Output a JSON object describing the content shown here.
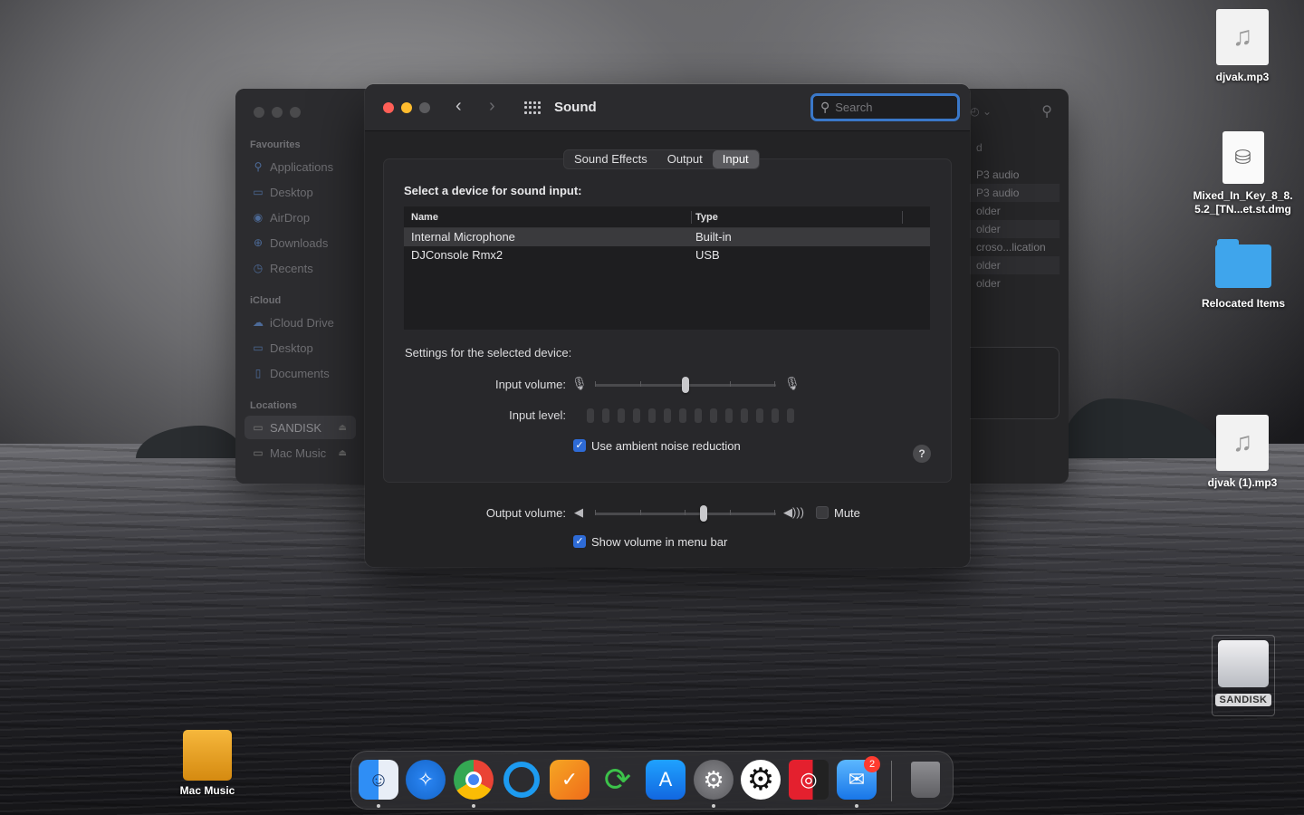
{
  "sound_window": {
    "title": "Sound",
    "search_placeholder": "Search",
    "tabs": [
      {
        "label": "Sound Effects",
        "active": false
      },
      {
        "label": "Output",
        "active": false
      },
      {
        "label": "Input",
        "active": true
      }
    ],
    "select_label": "Select a device for sound input:",
    "table": {
      "headers": [
        "Name",
        "Type"
      ],
      "rows": [
        {
          "name": "Internal Microphone",
          "type": "Built-in",
          "selected": true
        },
        {
          "name": "DJConsole Rmx2",
          "type": "USB",
          "selected": false
        }
      ]
    },
    "settings_label": "Settings for the selected device:",
    "input_volume_label": "Input volume:",
    "input_volume_level": 0.5,
    "input_level_label": "Input level:",
    "ambient_noise_label": "Use ambient noise reduction",
    "ambient_noise_checked": true,
    "help_label": "?",
    "output_volume_label": "Output volume:",
    "output_volume_level": 0.6,
    "mute_label": "Mute",
    "mute_checked": false,
    "show_volume_label": "Show volume in menu bar",
    "show_volume_checked": true
  },
  "finder_window": {
    "sections": [
      {
        "title": "Favourites",
        "items": [
          "Applications",
          "Desktop",
          "AirDrop",
          "Downloads",
          "Recents"
        ]
      },
      {
        "title": "iCloud",
        "items": [
          "iCloud Drive",
          "Desktop",
          "Documents"
        ]
      },
      {
        "title": "Locations",
        "items": [
          "SANDISK",
          "Mac Music"
        ]
      }
    ],
    "list_column_header": "d",
    "list_rows": [
      "P3 audio",
      "P3 audio",
      "older",
      "older",
      "croso...lication",
      "older",
      "older"
    ]
  },
  "desktop": {
    "icons": [
      {
        "label": "djvak.mp3"
      },
      {
        "label_line1": "Mixed_In_Key_8_8.",
        "label_line2": "5.2_[TN...et.st.dmg"
      },
      {
        "label": "Relocated Items"
      },
      {
        "label": "djvak (1).mp3"
      },
      {
        "label": "SANDISK"
      },
      {
        "label": "Mac Music"
      }
    ]
  },
  "dock": {
    "apps": [
      "Finder",
      "Safari",
      "Chrome",
      "Cortana",
      "Taskheat",
      "Sync",
      "App Store",
      "System Preferences",
      "Settings",
      "Music Downloader",
      "Mail",
      "Trash"
    ],
    "mail_badge": "2"
  },
  "colors": {
    "accent": "#2e6bd6",
    "search_focus": "#3a78c9",
    "window_bg": "#232325",
    "close": "#ff5f57",
    "minimize": "#febc2e"
  }
}
